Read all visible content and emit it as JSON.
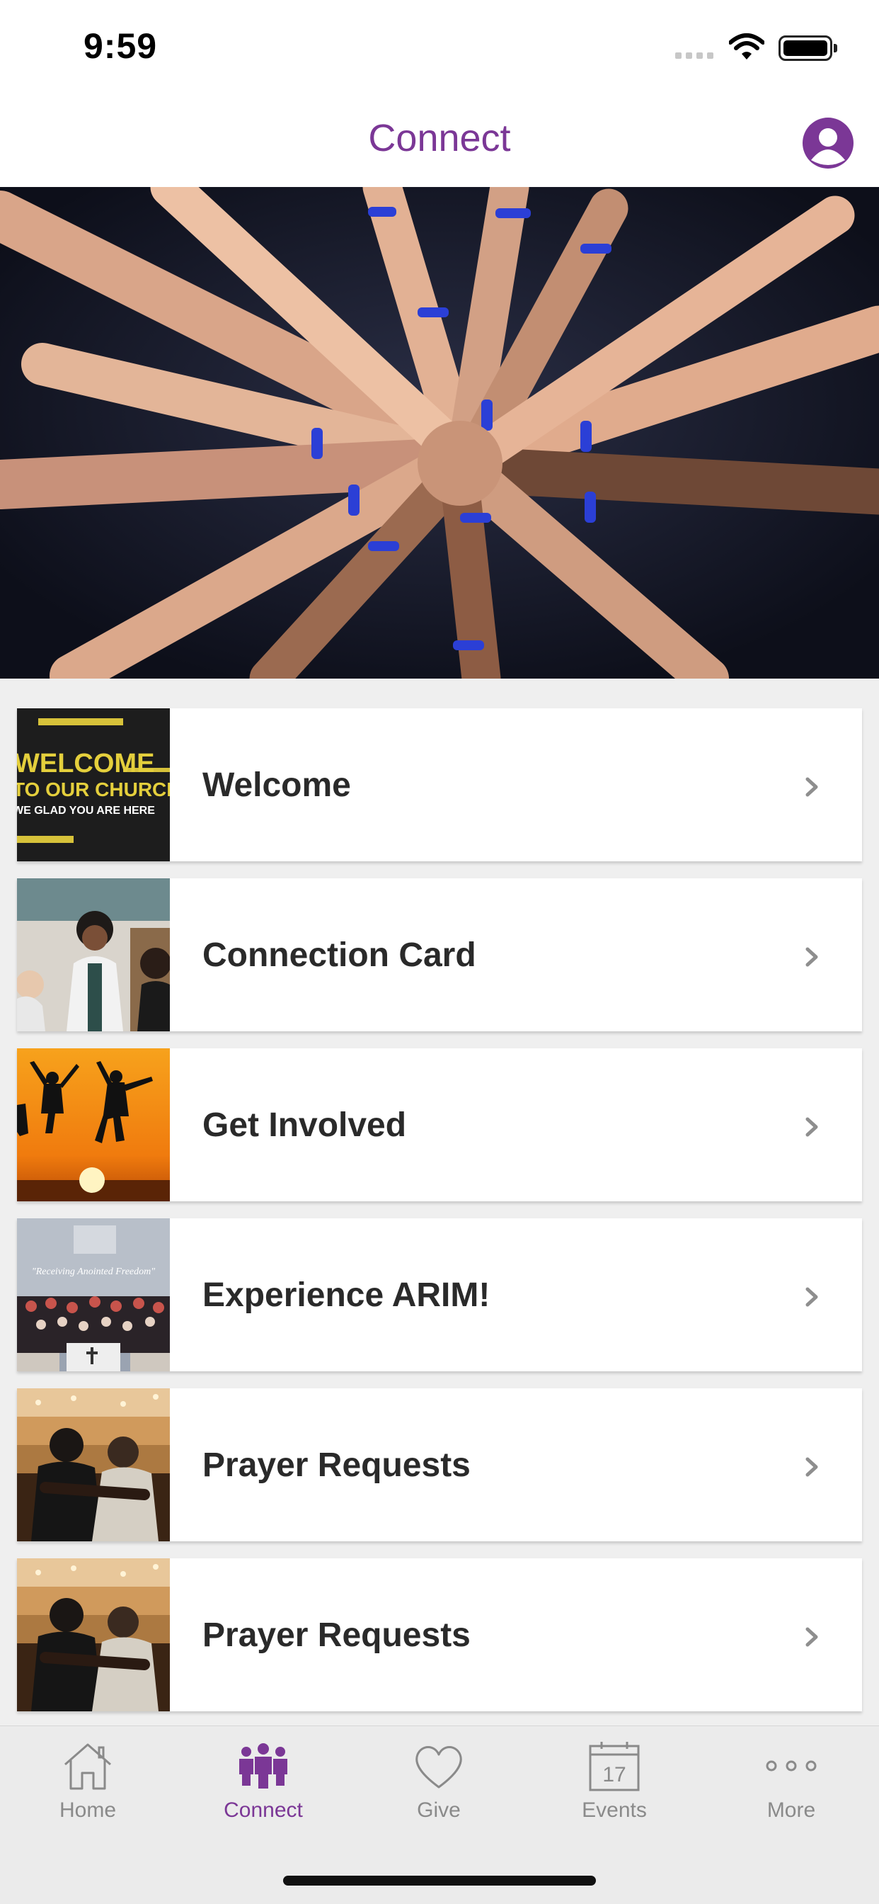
{
  "status_bar": {
    "time": "9:59"
  },
  "header": {
    "title": "Connect",
    "profile_icon": "profile-icon"
  },
  "colors": {
    "accent": "#7b3796",
    "tab_inactive": "#8a8a8a",
    "card_text": "#2a2a2a"
  },
  "list": {
    "items": [
      {
        "label": "Welcome",
        "thumb_text": [
          "WELCOME",
          "TO OUR CHURCH",
          "WE GLAD YOU ARE HERE"
        ]
      },
      {
        "label": "Connection Card"
      },
      {
        "label": "Get Involved"
      },
      {
        "label": "Experience ARIM!",
        "thumb_text": [
          "\"Receiving Anointed Freedom\""
        ]
      },
      {
        "label": "Prayer Requests"
      },
      {
        "label": "Prayer Requests"
      }
    ]
  },
  "tab_bar": {
    "tabs": [
      {
        "label": "Home",
        "icon": "home-icon",
        "active": false
      },
      {
        "label": "Connect",
        "icon": "people-icon",
        "active": true
      },
      {
        "label": "Give",
        "icon": "heart-icon",
        "active": false
      },
      {
        "label": "Events",
        "icon": "calendar-icon",
        "active": false,
        "icon_text": "17"
      },
      {
        "label": "More",
        "icon": "more-icon",
        "active": false
      }
    ]
  }
}
